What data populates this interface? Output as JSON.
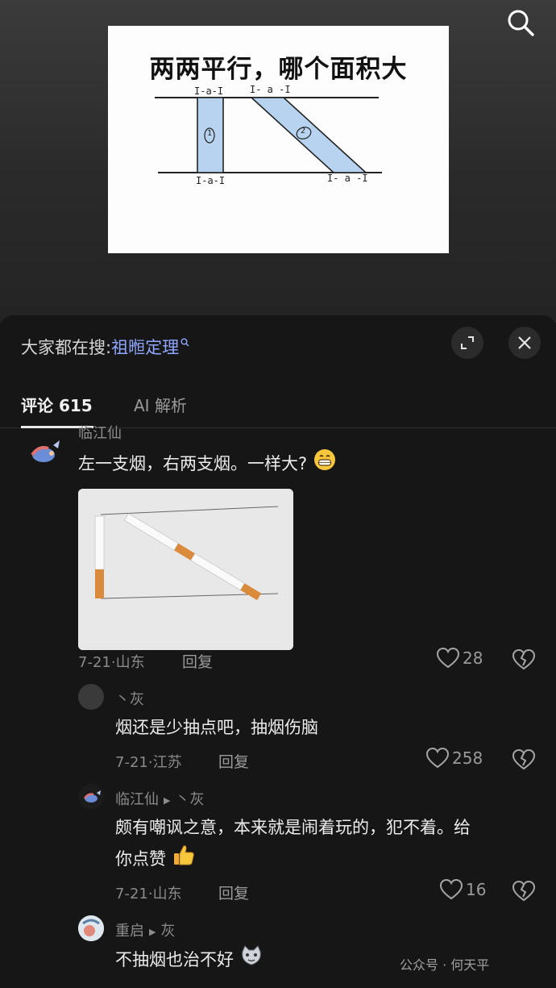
{
  "video": {
    "title": "两两平行，哪个面积大",
    "diagram_labels": {
      "top_left": "I-a-I",
      "top_right": "I- a -I",
      "bottom_left": "I-a-I",
      "bottom_right": "I- a -I",
      "region_1": "1",
      "region_2": "2"
    }
  },
  "search_button_icon": "search-icon",
  "sheet": {
    "search_hint_prefix": "大家都在搜:",
    "search_hint_term": "祖暅定理",
    "expand_icon": "expand-icon",
    "close_icon": "close-icon"
  },
  "tabs": {
    "comments_label": "评论 615",
    "ai_label": "AI 解析"
  },
  "comments": [
    {
      "username": "临江仙",
      "text": "左一支烟，右两支烟。一样大?",
      "emoji": "grin-emoji",
      "has_image": true,
      "meta": "7-21·山东",
      "reply_label": "回复",
      "likes": "28"
    },
    {
      "username": "丶灰",
      "text": "烟还是少抽点吧，抽烟伤脑",
      "meta": "7-21·江苏",
      "reply_label": "回复",
      "likes": "258"
    },
    {
      "username": "临江仙",
      "reply_to": "丶灰",
      "text_line1": "颇有嘲讽之意，本来就是闹着玩的，犯不着。给",
      "text_line2": "你点赞",
      "emoji": "thumbs-up-emoji",
      "meta": "7-21·山东",
      "reply_label": "回复",
      "likes": "16"
    },
    {
      "username": "重启",
      "reply_to": "灰",
      "text": "不抽烟也治不好",
      "emoji": "cat-emoji"
    }
  ],
  "watermark": "公众号 · 何天平",
  "colors": {
    "background": "#161616",
    "link": "#8fa7ff",
    "diagram_fill": "#b7d3ef"
  }
}
